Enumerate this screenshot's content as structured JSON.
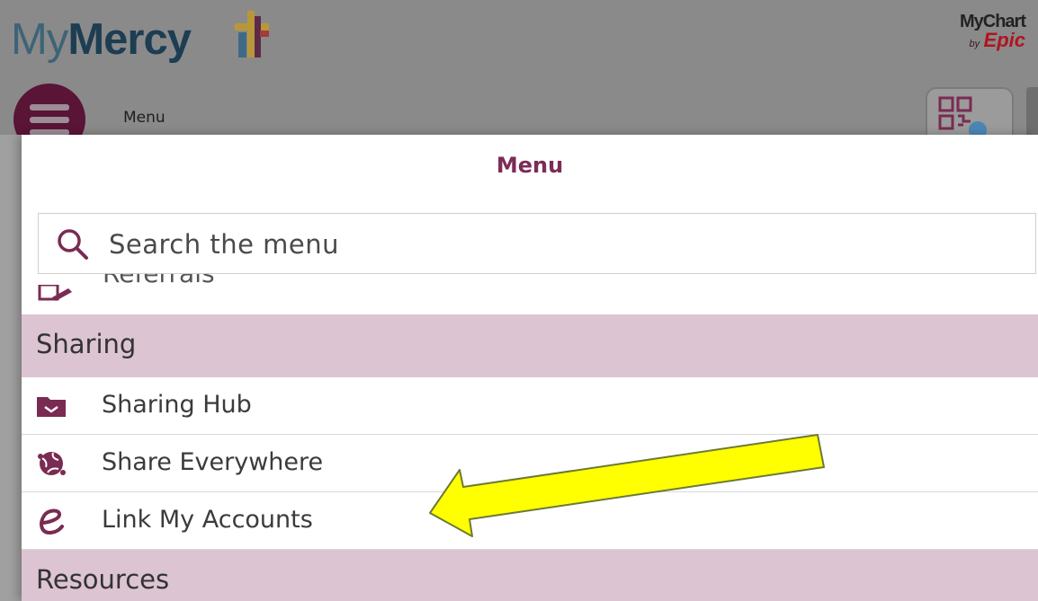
{
  "header": {
    "logo": {
      "my": "My",
      "mercy": "Mercy"
    },
    "mychart": {
      "name": "MyChart",
      "by": "by",
      "brand": "Epic"
    },
    "menu_toggle_label": "Menu",
    "icons": {
      "menu_toggle": "hamburger-icon",
      "qr": "qr-code-icon"
    }
  },
  "menu": {
    "title": "Menu",
    "search": {
      "placeholder": "Search the menu",
      "icon": "search-icon"
    },
    "partial_item": {
      "label": "Referrals",
      "icon": "referral-icon"
    },
    "sections": [
      {
        "title": "Sharing",
        "items": [
          {
            "label": "Sharing Hub",
            "icon": "folder-share-icon"
          },
          {
            "label": "Share Everywhere",
            "icon": "globe-share-icon"
          },
          {
            "label": "Link My Accounts",
            "icon": "link-accounts-icon"
          }
        ]
      },
      {
        "title": "Resources",
        "items": []
      }
    ]
  },
  "annotation": {
    "arrow_color": "#ffff00",
    "target": "Link My Accounts"
  },
  "colors": {
    "brand_plum": "#7d2b57",
    "section_bg": "#dcc4d2",
    "logo_navy": "#1d3d52",
    "epic_red": "#b0141e"
  }
}
